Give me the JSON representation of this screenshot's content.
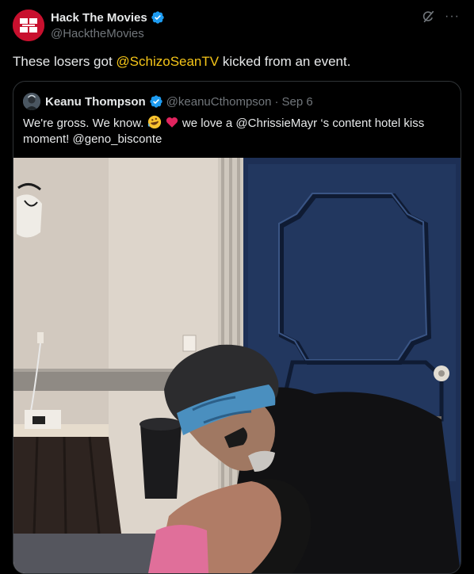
{
  "post": {
    "author_name": "Hack The Movies",
    "author_handle": "@HacktheMovies",
    "text_before": "These losers got ",
    "mention": "@SchizoSeanTV",
    "text_after": " kicked from an event.",
    "more_label": "···"
  },
  "quote": {
    "author_name": "Keanu Thompson",
    "author_handle": "@keanuCthompson",
    "separator": "·",
    "date": "Sep 6",
    "text_part1": "We're gross. We know. ",
    "text_part2": " we love a @ChrissieMayr ‘s content hotel kiss moment! @geno_bisconte"
  },
  "colors": {
    "background": "#000000",
    "accent_mention": "#f5c518",
    "verified_blue": "#1d9bf0",
    "muted_text": "#71767b",
    "border": "#2f3336"
  },
  "icons": {
    "avatar": "hack-the-movies-logo",
    "verified": "verified-badge-icon",
    "grok": "grok-icon",
    "more": "more-icon"
  }
}
